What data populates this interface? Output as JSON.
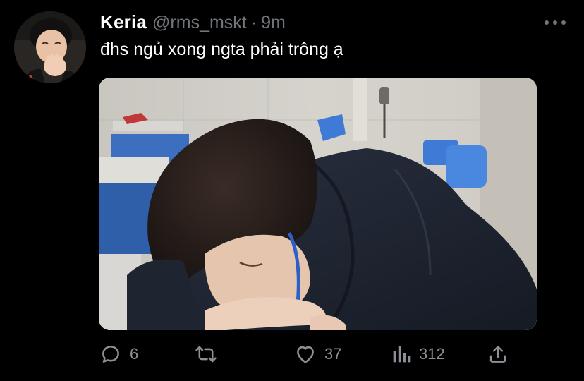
{
  "tweet": {
    "author": {
      "display_name": "Keria",
      "handle": "@rms_mskt"
    },
    "separator": "·",
    "time": "9m",
    "text": "đhs ngủ xong ngta phải trông ạ"
  },
  "actions": {
    "reply": {
      "icon": "reply-icon",
      "count": "6"
    },
    "retweet": {
      "icon": "retweet-icon"
    },
    "like": {
      "icon": "like-icon",
      "count": "37"
    },
    "views": {
      "icon": "views-icon",
      "count": "312"
    },
    "share": {
      "icon": "share-icon"
    }
  },
  "colors": {
    "background": "#000000",
    "primary_text": "#ffffff",
    "secondary_text": "#71767b"
  }
}
